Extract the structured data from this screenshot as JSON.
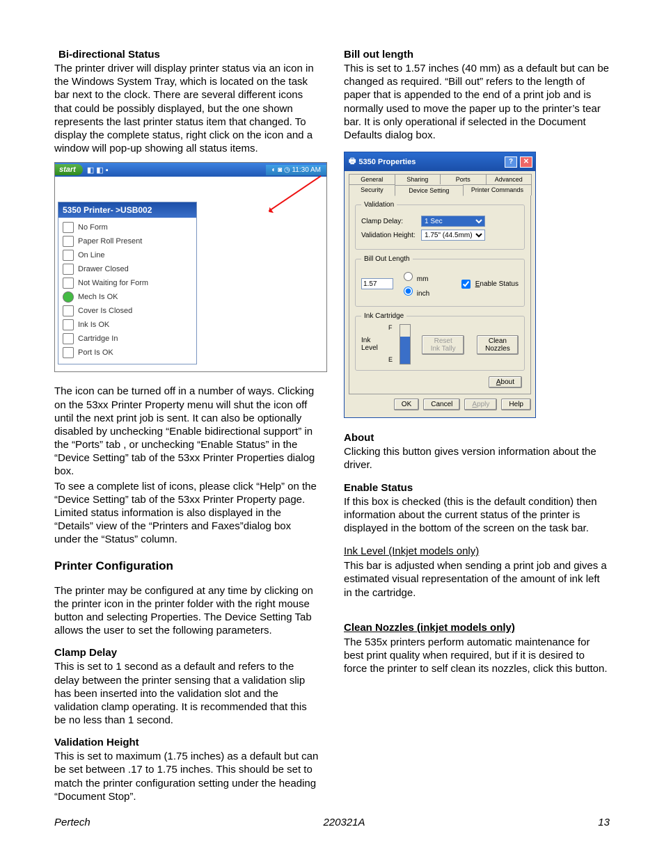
{
  "left": {
    "h_bidirectional": "Bi-directional Status",
    "p1": "The printer driver will display printer status via an icon in the Windows System Tray, which is located on the task bar next to the clock.  There are several different icons that could be possibly displayed, but the one shown represents the last printer status item that changed.  To display the complete status, right click on the icon and a window will pop-up showing all status items.",
    "p2": "The icon can be turned off in a number of ways.  Clicking on the 53xx Printer Property menu will shut the icon off until the next print job is sent.  It can also be optionally disabled by unchecking “Enable bidirectional support” in the “Ports” tab , or unchecking “Enable Status” in the “Device Setting” tab of the 53xx Printer Properties dialog box.",
    "p3": "To see a complete list of icons, please click “Help” on the “Device Setting” tab  of the 53xx Printer Property page.  Limited status information is also displayed in the “Details” view of the “Printers and Faxes”dialog box under the “Status” column.",
    "h_config": "Printer Configuration",
    "p4": "The printer may be configured at any time by clicking on the printer icon in the printer folder with the right mouse button and selecting Properties.  The Device Setting Tab allows the user to set the following parameters.",
    "h_clamp": "Clamp Delay",
    "p5": "This is set to 1 second as a default and refers to the delay between the printer sensing that a validation slip has been inserted into the validation slot  and the validation clamp operating.  It is recommended that this be no less than 1 second.",
    "h_val": "Validation Height",
    "p6": "This is set to maximum (1.75 inches) as a default but can be set between .17 to 1.75 inches.  This should be set to match the printer configuration setting under the heading “Document Stop”."
  },
  "right": {
    "h_bill": "Bill out length",
    "p1": "This is set to 1.57 inches (40 mm) as a default but can be changed as required.  “Bill out” refers to the length of paper that is appended to the end of a print  job and is normally used to move the paper up to the printer’s tear bar.  It is only operational if selected in the Document Defaults dialog box.",
    "h_about": "About",
    "p2": "Clicking this button gives version information about the driver.",
    "h_enable": "Enable Status",
    "p3": "If this box is checked (this is the default condition) then information about the current status of the printer is displayed in the bottom of the screen on the task bar.",
    "h_ink": "Ink Level (Inkjet models only)",
    "p4": "This bar is adjusted when sending a print job and gives a estimated visual representation of the amount of ink left in the cartridge.",
    "h_clean": "Clean Nozzles (inkjet models only)",
    "p5": "The 535x printers perform automatic maintenance for best print quality when required, but if it is desired to force the printer to self clean its nozzles,  click this button."
  },
  "popup": {
    "title": "5350 Printer- >USB002",
    "start": "start",
    "tray": "11:30 AM",
    "items": [
      "No Form",
      "Paper Roll Present",
      "On Line",
      "Drawer Closed",
      "Not Waiting for Form",
      "Mech Is OK",
      "Cover Is Closed",
      "Ink Is OK",
      "Cartridge In",
      "Port Is OK"
    ]
  },
  "dlg": {
    "title": "5350 Properties",
    "tabs_top": [
      "General",
      "Sharing",
      "Ports",
      "Advanced"
    ],
    "tabs_bot": [
      "Security",
      "Device Setting",
      "Printer Commands"
    ],
    "validation_legend": "Validation",
    "clamp_label": "Clamp Delay:",
    "clamp_value": "1 Sec",
    "valheight_label": "Validation Height:",
    "valheight_value": "1.75\" (44.5mm)",
    "bill_legend": "Bill Out Length",
    "bill_value": "1.57",
    "unit_mm": "mm",
    "unit_inch": "inch",
    "enable_status": "Enable Status",
    "ink_legend": "Ink Cartridge",
    "ink_level": "Ink Level",
    "ink_f": "F",
    "ink_e": "E",
    "reset": "Reset Ink Tally",
    "clean": "Clean Nozzles",
    "about": "About",
    "ok": "OK",
    "cancel": "Cancel",
    "apply": "Apply",
    "help": "Help"
  },
  "footer": {
    "l": "Pertech",
    "c": "220321A",
    "r": "13"
  }
}
